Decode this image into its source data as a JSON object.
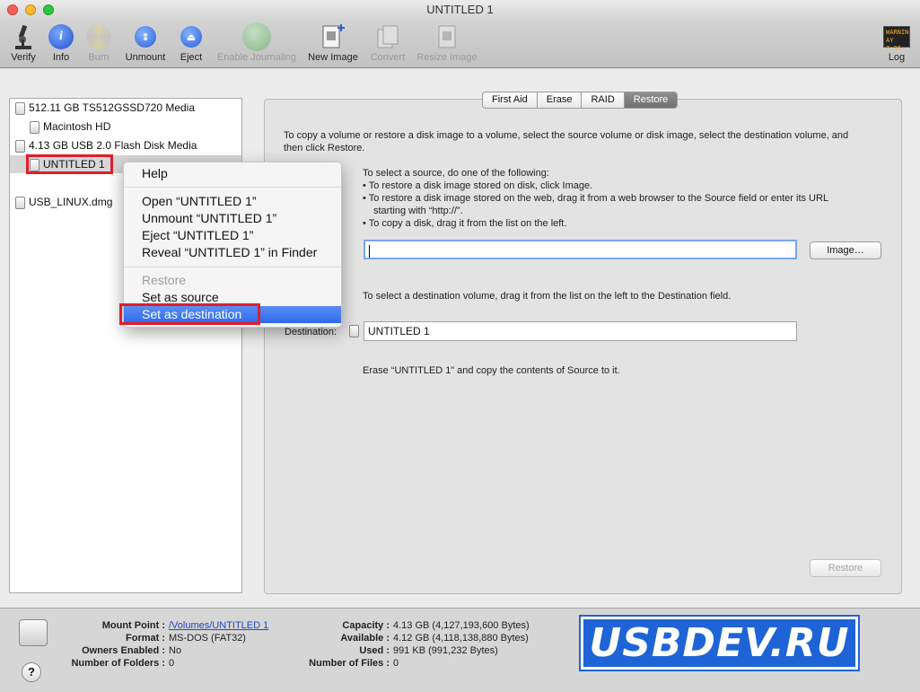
{
  "window": {
    "title": "UNTITLED 1"
  },
  "toolbar": {
    "verify": "Verify",
    "info": "Info",
    "burn": "Burn",
    "unmount": "Unmount",
    "eject": "Eject",
    "enable_journaling": "Enable Journaling",
    "new_image": "New Image",
    "convert": "Convert",
    "resize_image": "Resize Image",
    "log": "Log",
    "log_badge_line1": "WARNIN",
    "log_badge_line2": "AY 7:36"
  },
  "sidebar": {
    "items": [
      {
        "label": "512.11 GB TS512GSSD720 Media"
      },
      {
        "label": "Macintosh HD"
      },
      {
        "label": "4.13 GB USB 2.0 Flash Disk Media"
      },
      {
        "label": "UNTITLED 1"
      },
      {
        "label": "USB_LINUX.dmg"
      }
    ]
  },
  "tabs": [
    "First Aid",
    "Erase",
    "RAID",
    "Restore"
  ],
  "restore": {
    "intro": "To copy a volume or restore a disk image to a volume, select the source volume or disk image, select the destination volume, and then click Restore.",
    "source_heading": "To select a source, do one of the following:",
    "bullet1": "• To restore a disk image stored on disk, click Image.",
    "bullet2": "• To restore a disk image stored on the web, drag it from a web browser to the Source field or enter its URL",
    "bullet2b": "starting with “http://”.",
    "bullet3": "• To copy a disk, drag it from the list on the left.",
    "source_value": "",
    "image_button": "Image…",
    "dest_heading": "To select a destination volume, drag it from the list on the left to the Destination field.",
    "dest_label": "Destination:",
    "dest_value": "UNTITLED 1",
    "erase_note": "Erase “UNTITLED 1” and copy the contents of Source to it.",
    "restore_button": "Restore"
  },
  "context_menu": {
    "help": "Help",
    "open": "Open “UNTITLED 1”",
    "unmount": "Unmount “UNTITLED 1”",
    "eject": "Eject “UNTITLED 1”",
    "reveal": "Reveal “UNTITLED 1” in Finder",
    "restore": "Restore",
    "set_source": "Set as source",
    "set_destination": "Set as destination"
  },
  "details": {
    "mount_point_label": "Mount Point :",
    "mount_point": "/Volumes/UNTITLED 1",
    "format_label": "Format :",
    "format": "MS-DOS (FAT32)",
    "owners_label": "Owners Enabled :",
    "owners": "No",
    "folders_label": "Number of Folders :",
    "folders": "0",
    "capacity_label": "Capacity :",
    "capacity": "4.13 GB (4,127,193,600 Bytes)",
    "available_label": "Available :",
    "available": "4.12 GB (4,118,138,880 Bytes)",
    "used_label": "Used :",
    "used": "991 KB (991,232 Bytes)",
    "files_label": "Number of Files :",
    "files": "0"
  },
  "watermark": "USBDEV.RU",
  "colors": {
    "highlight": "#3a75ef",
    "annotation_red": "#e11d2a",
    "watermark_blue": "#1e64d6"
  }
}
